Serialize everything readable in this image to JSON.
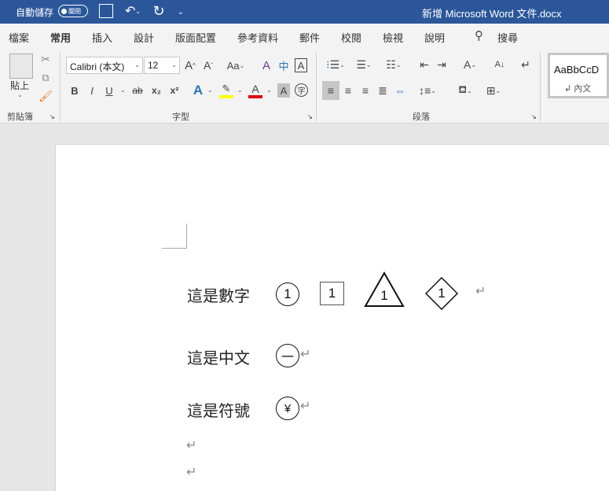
{
  "titlebar": {
    "autosave_label": "自動儲存",
    "autosave_state": "關閉",
    "doc_title": "新增 Microsoft Word 文件.docx"
  },
  "tabs": [
    "檔案",
    "常用",
    "插入",
    "設計",
    "版面配置",
    "參考資料",
    "郵件",
    "校閱",
    "檢視",
    "說明"
  ],
  "search_label": "搜尋",
  "clipboard": {
    "paste": "貼上",
    "group": "剪貼簿"
  },
  "font": {
    "name": "Calibri (本文)",
    "size": "12",
    "group": "字型",
    "change_case": "Aa",
    "bold": "B",
    "italic": "I",
    "underline": "U",
    "strike": "ab",
    "sub": "x₂",
    "sup": "x²"
  },
  "paragraph": {
    "group": "段落"
  },
  "styles": {
    "preview": "AaBbCcD",
    "name": "↲ 內文"
  },
  "document": {
    "lines": [
      {
        "label": "這是數字",
        "symbols": [
          "1",
          "1",
          "1",
          "1"
        ]
      },
      {
        "label": "這是中文",
        "symbols": [
          "一"
        ]
      },
      {
        "label": "這是符號",
        "symbols": [
          "¥"
        ]
      }
    ],
    "paragraph_mark": "↵"
  }
}
